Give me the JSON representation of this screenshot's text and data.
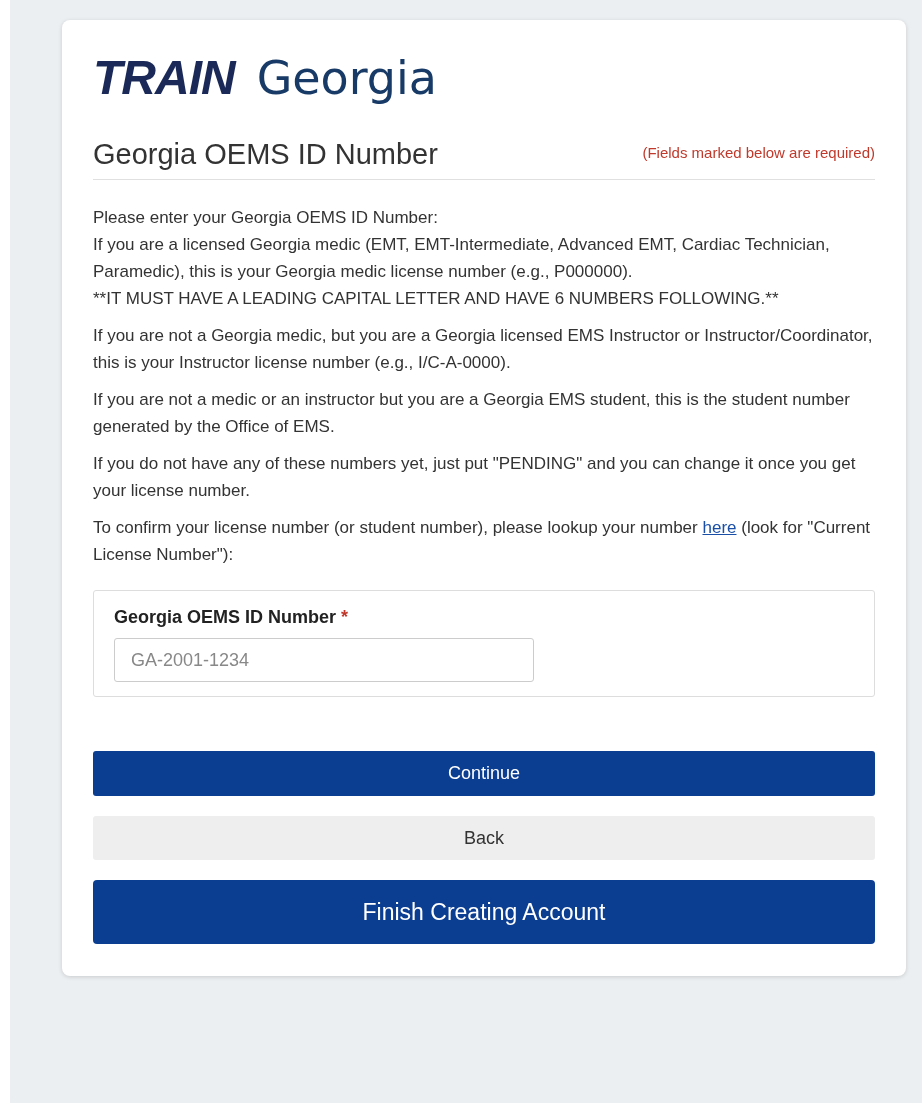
{
  "logo": {
    "brand": "TRAIN",
    "region": "Georgia"
  },
  "header": {
    "title": "Georgia OEMS ID Number",
    "required_note": "(Fields marked below are required)"
  },
  "instructions": [
    {
      "lines": [
        "Please enter your Georgia OEMS ID Number:",
        "If you are a licensed Georgia medic (EMT, EMT-Intermediate, Advanced EMT, Cardiac Technician, Paramedic), this is your Georgia medic license number (e.g., P000000).",
        "**IT MUST HAVE A LEADING CAPITAL LETTER AND HAVE 6 NUMBERS FOLLOWING.**"
      ]
    },
    {
      "lines": [
        "If you are not a Georgia medic, but you are a Georgia licensed EMS Instructor or Instructor/Coordinator, this is your Instructor license number (e.g., I/C-A-0000)."
      ]
    },
    {
      "lines": [
        "If you are not a medic or an instructor but you are a Georgia EMS student, this is the student number generated by the Office of EMS."
      ]
    },
    {
      "lines": [
        "If you do not have any of these numbers yet, just put \"PENDING\" and you can change it once you get your license number."
      ]
    }
  ],
  "lookup": {
    "before": "To confirm your license number (or student number), please lookup your number ",
    "link": "here",
    "after": " (look for \"Current License Number\"):"
  },
  "field": {
    "label": "Georgia OEMS ID Number",
    "required_mark": "*",
    "placeholder": "GA-2001-1234"
  },
  "buttons": [
    {
      "label": "Continue",
      "kind": "primary"
    },
    {
      "label": "Back",
      "kind": "secondary"
    },
    {
      "label": "Finish Creating Account",
      "kind": "large"
    }
  ]
}
